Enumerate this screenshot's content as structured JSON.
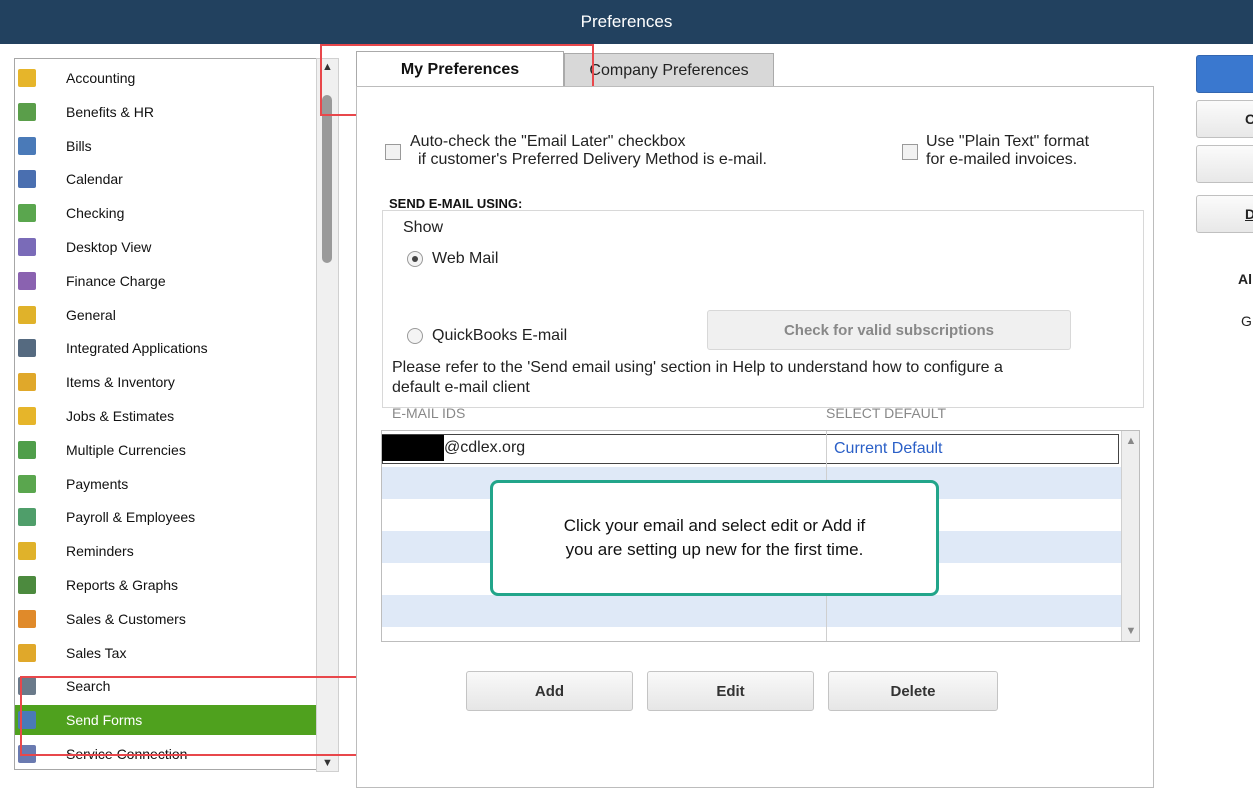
{
  "window": {
    "title": "Preferences"
  },
  "sidebar": {
    "items": [
      {
        "label": "Accounting",
        "icon": "accounting-icon",
        "color": "#e6b52a"
      },
      {
        "label": "Benefits & HR",
        "icon": "benefits-icon",
        "color": "#5a9e4a"
      },
      {
        "label": "Bills",
        "icon": "bills-icon",
        "color": "#4a7ab8"
      },
      {
        "label": "Calendar",
        "icon": "calendar-icon",
        "color": "#4a6fb0"
      },
      {
        "label": "Checking",
        "icon": "checking-icon",
        "color": "#5aa64e"
      },
      {
        "label": "Desktop View",
        "icon": "desktop-view-icon",
        "color": "#7a6bb8"
      },
      {
        "label": "Finance Charge",
        "icon": "finance-charge-icon",
        "color": "#8a62b0"
      },
      {
        "label": "General",
        "icon": "general-icon",
        "color": "#e0b22a"
      },
      {
        "label": "Integrated Applications",
        "icon": "integrated-apps-icon",
        "color": "#556a80"
      },
      {
        "label": "Items & Inventory",
        "icon": "inventory-icon",
        "color": "#e0a82a"
      },
      {
        "label": "Jobs & Estimates",
        "icon": "jobs-icon",
        "color": "#e6b52a"
      },
      {
        "label": "Multiple Currencies",
        "icon": "currencies-icon",
        "color": "#4f9e4a"
      },
      {
        "label": "Payments",
        "icon": "payments-icon",
        "color": "#5aa64e"
      },
      {
        "label": "Payroll & Employees",
        "icon": "payroll-icon",
        "color": "#4f9e6a"
      },
      {
        "label": "Reminders",
        "icon": "reminders-icon",
        "color": "#e0b22a"
      },
      {
        "label": "Reports & Graphs",
        "icon": "reports-icon",
        "color": "#4c8a3e"
      },
      {
        "label": "Sales & Customers",
        "icon": "sales-icon",
        "color": "#e08a2a"
      },
      {
        "label": "Sales Tax",
        "icon": "sales-tax-icon",
        "color": "#e0a82a"
      },
      {
        "label": "Search",
        "icon": "search-icon",
        "color": "#6a7a8a"
      },
      {
        "label": "Send Forms",
        "icon": "send-forms-icon",
        "color": "#4a7ab8"
      },
      {
        "label": "Service Connection",
        "icon": "service-connection-icon",
        "color": "#6a7ab0"
      }
    ],
    "selected": "Send Forms"
  },
  "tabs": {
    "my": "My Preferences",
    "company": "Company Preferences"
  },
  "options": {
    "email_later_line1": "Auto-check the \"Email Later\" checkbox",
    "email_later_line2": "if customer's Preferred Delivery Method is e-mail.",
    "plain_text_line1": "Use \"Plain Text\" format",
    "plain_text_line2": "for e-mailed invoices."
  },
  "send_email": {
    "section_label": "SEND E-MAIL USING:",
    "show_label": "Show",
    "web_mail": "Web Mail",
    "qb_email": "QuickBooks E-mail",
    "check_btn": "Check for valid subscriptions",
    "help_line1": "Please refer to the 'Send email using' section in Help to understand how to configure a",
    "help_line2": "default e-mail client"
  },
  "grid": {
    "col_ids": "E-MAIL IDS",
    "col_default": "SELECT DEFAULT",
    "row1_email": "@cdlex.org",
    "row1_default": "Current Default"
  },
  "callout": {
    "line1": "Click your email and select edit or Add if",
    "line2": "you are setting up new for the first time."
  },
  "buttons": {
    "add": "Add",
    "edit": "Edit",
    "delete": "Delete"
  },
  "right": {
    "label1": "Al",
    "label2": "G"
  },
  "colors": {
    "titlebar": "#22415f",
    "selected": "#4fa11e",
    "callout": "#22a58a",
    "highlight": "#e8474b",
    "link": "#2a5fc7"
  }
}
